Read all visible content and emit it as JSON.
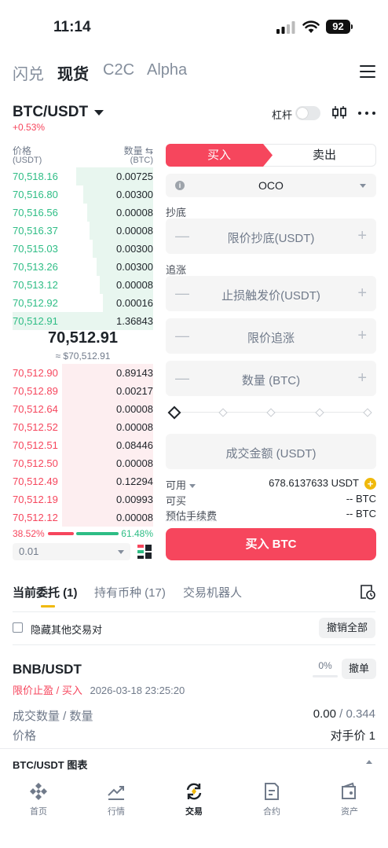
{
  "status_bar": {
    "time": "11:14",
    "battery": "92"
  },
  "top_tabs": [
    "闪兑",
    "现货",
    "C2C",
    "Alpha"
  ],
  "pair": {
    "name": "BTC/USDT",
    "change": "+0.53%",
    "leverage_label": "杠杆"
  },
  "order_book": {
    "price_header": "价格",
    "price_unit": "(USDT)",
    "qty_header": "数量 ⇆",
    "qty_unit": "(BTC)",
    "buys": [
      {
        "price": "70,518.16",
        "qty": "0.00725",
        "depth": 0.55
      },
      {
        "price": "70,516.80",
        "qty": "0.00300",
        "depth": 0.5
      },
      {
        "price": "70,516.56",
        "qty": "0.00008",
        "depth": 0.47
      },
      {
        "price": "70,516.37",
        "qty": "0.00008",
        "depth": 0.45
      },
      {
        "price": "70,515.03",
        "qty": "0.00300",
        "depth": 0.43
      },
      {
        "price": "70,513.26",
        "qty": "0.00300",
        "depth": 0.4
      },
      {
        "price": "70,513.12",
        "qty": "0.00008",
        "depth": 0.38
      },
      {
        "price": "70,512.92",
        "qty": "0.00016",
        "depth": 0.36
      },
      {
        "price": "70,512.91",
        "qty": "1.36843",
        "depth": 1.0
      }
    ],
    "mid_price": "70,512.91",
    "mid_usd": "≈ $70,512.91",
    "sells": [
      {
        "price": "70,512.90",
        "qty": "0.89143",
        "depth": 0.65
      },
      {
        "price": "70,512.89",
        "qty": "0.00217",
        "depth": 0.65
      },
      {
        "price": "70,512.64",
        "qty": "0.00008",
        "depth": 0.65
      },
      {
        "price": "70,512.52",
        "qty": "0.00008",
        "depth": 0.65
      },
      {
        "price": "70,512.51",
        "qty": "0.08446",
        "depth": 0.65
      },
      {
        "price": "70,512.50",
        "qty": "0.00008",
        "depth": 0.65
      },
      {
        "price": "70,512.49",
        "qty": "0.12294",
        "depth": 0.65
      },
      {
        "price": "70,512.19",
        "qty": "0.00993",
        "depth": 0.65
      },
      {
        "price": "70,512.12",
        "qty": "0.00008",
        "depth": 0.65
      }
    ],
    "buy_ratio": "38.52%",
    "sell_ratio": "61.48%",
    "buy_ratio_value": 0.3852,
    "depth_select": "0.01"
  },
  "order_form": {
    "buy_tab": "买入",
    "sell_tab": "卖出",
    "order_type": "OCO",
    "section_dip": "抄底",
    "limit_dip_placeholder": "限价抄底(USDT)",
    "section_chase": "追涨",
    "stop_trigger_placeholder": "止损触发价(USDT)",
    "limit_chase_placeholder": "限价追涨",
    "qty_placeholder": "数量 (BTC)",
    "amount_placeholder": "成交金额 (USDT)",
    "available_label": "可用",
    "available_value": "678.6137633 USDT",
    "can_buy_label": "可买",
    "can_buy_value": "-- BTC",
    "fee_label": "预估手续费",
    "fee_value": "-- BTC",
    "buy_button": "买入 BTC"
  },
  "orders": {
    "tabs": [
      "当前委托 (1)",
      "持有币种 (17)",
      "交易机器人"
    ],
    "hide_other_pairs": "隐藏其他交易对",
    "cancel_all": "撤销全部",
    "items": [
      {
        "pair": "BNB/USDT",
        "type": "限价止盈 / 买入",
        "time": "2026-03-18 23:25:20",
        "filled_pct": "0%",
        "cancel": "撤单",
        "filled_label": "成交数量 / 数量",
        "filled_value": "0.00",
        "total_value": "/ 0.344",
        "price_label": "价格",
        "price_value": "对手价 1"
      }
    ]
  },
  "chart_toggle": "BTC/USDT 图表",
  "tab_bar": [
    {
      "label": "首页",
      "icon": "home-icon"
    },
    {
      "label": "行情",
      "icon": "markets-icon"
    },
    {
      "label": "交易",
      "icon": "trade-icon"
    },
    {
      "label": "合约",
      "icon": "futures-icon"
    },
    {
      "label": "资产",
      "icon": "wallet-icon"
    }
  ]
}
